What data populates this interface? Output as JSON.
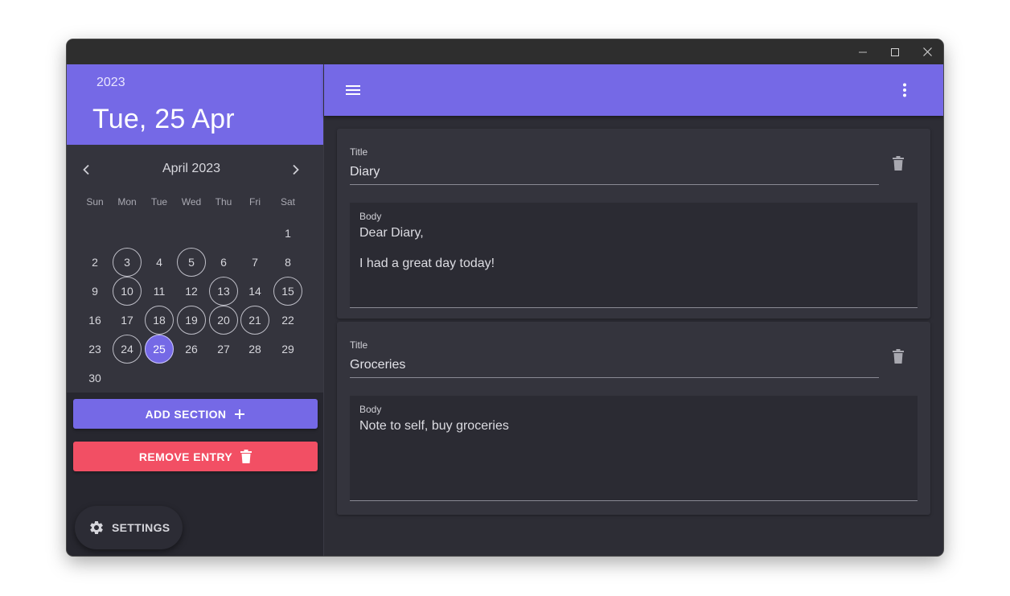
{
  "window": {
    "controls": {
      "minimize_icon": "minimize-icon",
      "maximize_icon": "maximize-icon",
      "close_icon": "close-icon"
    }
  },
  "sidebar": {
    "year": "2023",
    "selected_date": "Tue, 25 Apr",
    "calendar": {
      "month_label": "April 2023",
      "prev_icon": "chevron-left-icon",
      "next_icon": "chevron-right-icon",
      "weekdays": [
        "Sun",
        "Mon",
        "Tue",
        "Wed",
        "Thu",
        "Fri",
        "Sat"
      ],
      "first_weekday_index": 6,
      "days_in_month": 30,
      "days_with_entries": [
        3,
        5,
        10,
        13,
        15,
        18,
        19,
        20,
        21,
        24,
        25
      ],
      "selected_day": 25
    },
    "add_section": {
      "label": "ADD SECTION",
      "icon": "plus-icon"
    },
    "remove_entry": {
      "label": "REMOVE ENTRY",
      "icon": "trash-icon"
    },
    "settings": {
      "label": "SETTINGS",
      "icon": "gear-icon"
    }
  },
  "appbar": {
    "menu_icon": "hamburger-menu-icon",
    "more_icon": "more-vertical-icon"
  },
  "sections": [
    {
      "title_label": "Title",
      "title_value": "Diary",
      "body_label": "Body",
      "body_paragraphs": [
        "Dear Diary,",
        "I had a great day today!"
      ],
      "delete_icon": "trash-icon"
    },
    {
      "title_label": "Title",
      "title_value": "Groceries",
      "body_label": "Body",
      "body_paragraphs": [
        "Note to self, buy groceries"
      ],
      "delete_icon": "trash-icon"
    }
  ],
  "colors": {
    "accent": "#7569e6",
    "danger": "#f24f64",
    "sidebar_bg": "#27272f",
    "calendar_bg": "#34343d",
    "main_bg": "#2d2d35",
    "card_bg": "#34343d"
  }
}
